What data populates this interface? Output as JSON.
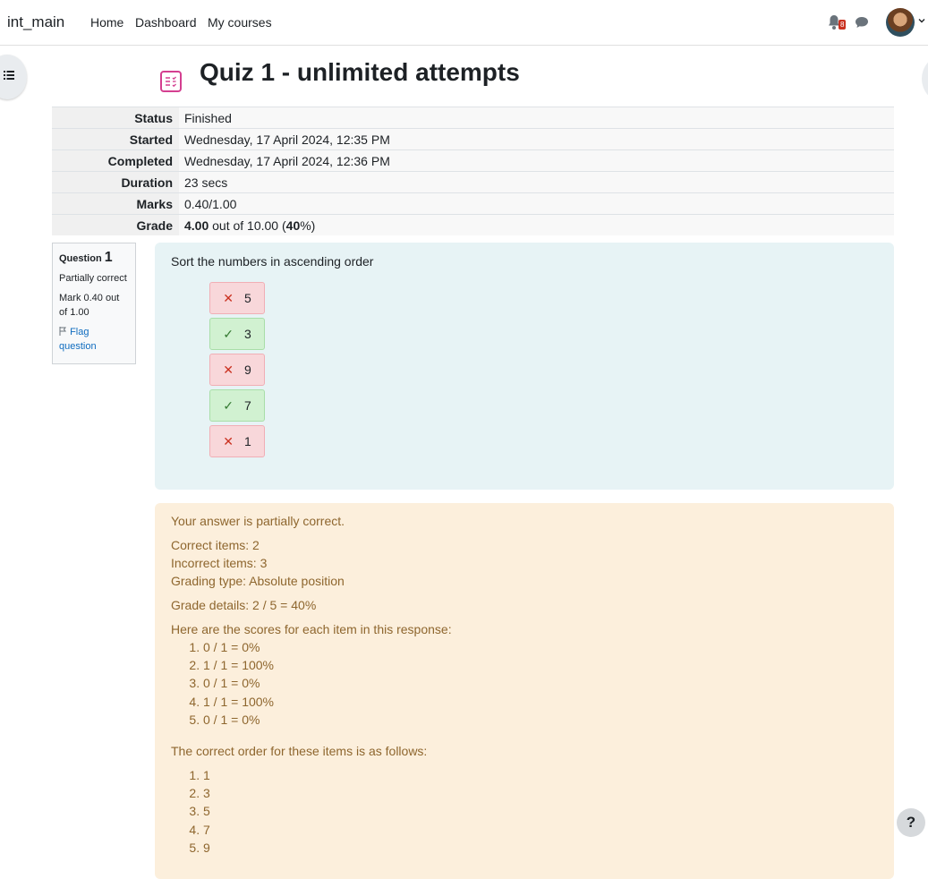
{
  "nav": {
    "site_name": "int_main",
    "links": [
      "Home",
      "Dashboard",
      "My courses"
    ],
    "notification_count": "8"
  },
  "page": {
    "title": "Quiz 1 - unlimited attempts"
  },
  "summary": [
    {
      "label": "Status",
      "value": "Finished"
    },
    {
      "label": "Started",
      "value": "Wednesday, 17 April 2024, 12:35 PM"
    },
    {
      "label": "Completed",
      "value": "Wednesday, 17 April 2024, 12:36 PM"
    },
    {
      "label": "Duration",
      "value": "23 secs"
    },
    {
      "label": "Marks",
      "value": "0.40/1.00"
    }
  ],
  "grade": {
    "label": "Grade",
    "score": "4.00",
    "out_of": " out of 10.00 (",
    "percent": "40",
    "end": "%)"
  },
  "question_info": {
    "question_label": "Question",
    "number": "1",
    "state": "Partially correct",
    "mark": "Mark 0.40 out of 1.00",
    "flag": "Flag question"
  },
  "question": {
    "text": "Sort the numbers in ascending order",
    "items": [
      {
        "value": "5",
        "correct": false
      },
      {
        "value": "3",
        "correct": true
      },
      {
        "value": "9",
        "correct": false
      },
      {
        "value": "7",
        "correct": true
      },
      {
        "value": "1",
        "correct": false
      }
    ]
  },
  "feedback": {
    "summary": "Your answer is partially correct.",
    "correct_items": "Correct items: 2",
    "incorrect_items": "Incorrect items: 3",
    "grading_type": "Grading type: Absolute position",
    "grade_details": "Grade details: 2 / 5 = 40%",
    "scores_heading": "Here are the scores for each item in this response:",
    "scores": [
      "0 / 1 = 0%",
      "1 / 1 = 100%",
      "0 / 1 = 0%",
      "1 / 1 = 100%",
      "0 / 1 = 0%"
    ],
    "order_heading": "The correct order for these items is as follows:",
    "correct_order": [
      "1",
      "3",
      "5",
      "7",
      "9"
    ]
  },
  "help": {
    "label": "?"
  },
  "colors": {
    "brand": "#0f6cbf",
    "correct_bg": "#d1f1d1",
    "incorrect_bg": "#f8d7da",
    "feedback_bg": "#fcefdc",
    "formulation_bg": "#e7f3f5"
  }
}
